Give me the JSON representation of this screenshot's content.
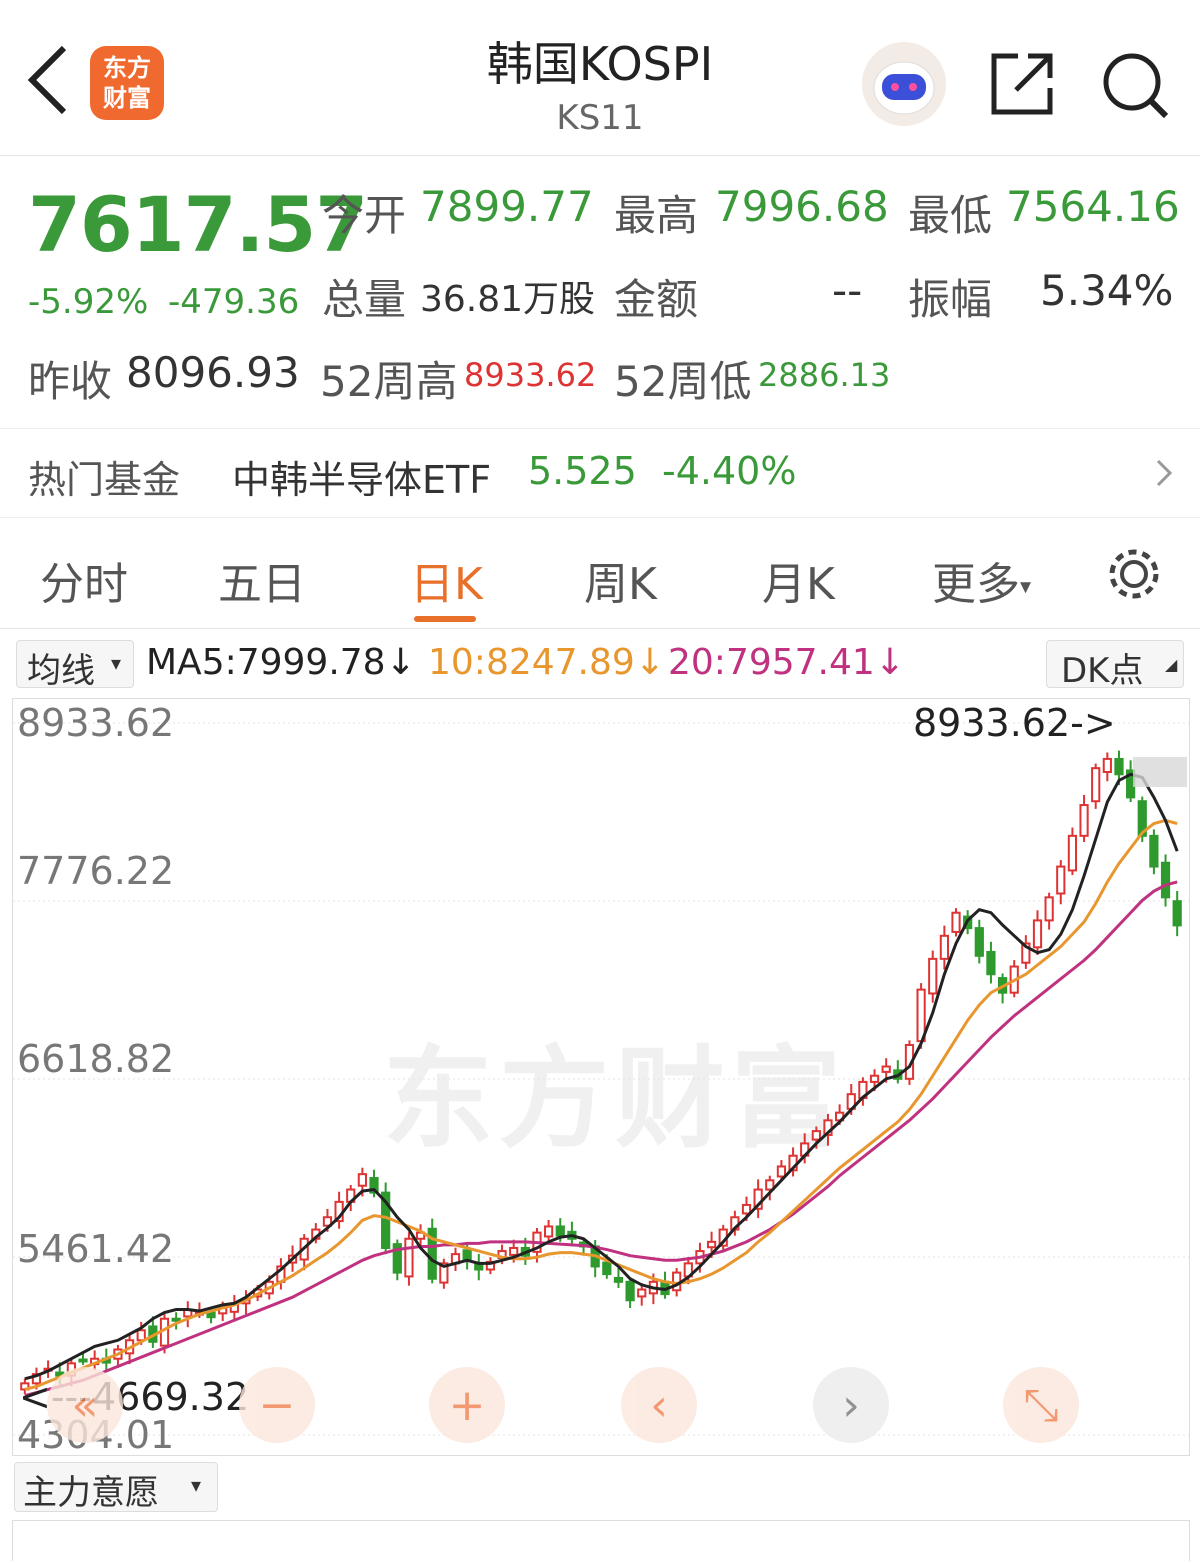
{
  "header": {
    "title": "韩国KOSPI",
    "subtitle": "KS11",
    "logo_line1": "东方",
    "logo_line2": "财富"
  },
  "quote": {
    "price": "7617.57",
    "pct_change": "-5.92%",
    "change": "-479.36",
    "open_label": "今开",
    "open": "7899.77",
    "high_label": "最高",
    "high": "7996.68",
    "low_label": "最低",
    "low": "7564.16",
    "volume_label": "总量",
    "volume": "36.81万股",
    "amount_label": "金额",
    "amount": "--",
    "amplitude_label": "振幅",
    "amplitude": "5.34%",
    "prev_close_label": "昨收",
    "prev_close": "8096.93",
    "w52_high_label": "52周高",
    "w52_high": "8933.62",
    "w52_low_label": "52周低",
    "w52_low": "2886.13"
  },
  "fund": {
    "label": "热门基金",
    "name": "中韩半导体ETF",
    "price": "5.525",
    "change": "-4.40%"
  },
  "tabs": [
    "分时",
    "五日",
    "日K",
    "周K",
    "月K",
    "更多"
  ],
  "active_tab": "日K",
  "ma": {
    "selector": "均线",
    "ma5": "MA5:7999.78",
    "ma10": "10:8247.89",
    "ma20": "20:7957.41",
    "arrow": "↓",
    "dk_button": "DK点"
  },
  "chart_data": {
    "type": "candlestick",
    "y_ticks": [
      "8933.62",
      "7776.22",
      "6618.82",
      "5461.42",
      "4304.01"
    ],
    "ylim": [
      4304.01,
      8933.62
    ],
    "max_annotation": "8933.62->",
    "min_annotation": "<---4669.32",
    "watermark": "东方财富",
    "colors": {
      "up": "#d33",
      "down": "#2e9a2e",
      "ma5": "#222222",
      "ma10": "#e8962e",
      "ma20": "#c0317f"
    },
    "closes": [
      4640,
      4700,
      4735,
      4690,
      4770,
      4790,
      4800,
      4775,
      4860,
      4920,
      4985,
      4910,
      5060,
      5050,
      5120,
      5100,
      5070,
      5130,
      5160,
      5180,
      5250,
      5300,
      5400,
      5470,
      5580,
      5640,
      5720,
      5820,
      5900,
      6000,
      5880,
      5520,
      5360,
      5580,
      5620,
      5320,
      5420,
      5480,
      5440,
      5380,
      5430,
      5500,
      5520,
      5470,
      5620,
      5660,
      5600,
      5580,
      5530,
      5400,
      5350,
      5300,
      5180,
      5250,
      5300,
      5220,
      5360,
      5420,
      5500,
      5560,
      5640,
      5720,
      5800,
      5900,
      5960,
      6050,
      6120,
      6200,
      6280,
      6350,
      6400,
      6520,
      6600,
      6640,
      6700,
      6620,
      6840,
      7200,
      7400,
      7550,
      7700,
      7600,
      7420,
      7300,
      7180,
      7350,
      7500,
      7650,
      7800,
      8000,
      8200,
      8400,
      8640,
      8700,
      8600,
      8450,
      8200,
      8000,
      7800,
      7617.57
    ],
    "ma5": [
      4669.32,
      4690,
      4720,
      4760,
      4800,
      4840,
      4880,
      4900,
      4920,
      4960,
      5000,
      5060,
      5100,
      5120,
      5120,
      5110,
      5130,
      5150,
      5160,
      5200,
      5260,
      5320,
      5380,
      5450,
      5520,
      5590,
      5650,
      5720,
      5820,
      5890,
      5900,
      5820,
      5720,
      5640,
      5520,
      5440,
      5400,
      5420,
      5440,
      5420,
      5420,
      5440,
      5460,
      5490,
      5520,
      5560,
      5590,
      5600,
      5580,
      5520,
      5460,
      5400,
      5320,
      5280,
      5260,
      5250,
      5280,
      5330,
      5400,
      5480,
      5560,
      5650,
      5720,
      5800,
      5880,
      5960,
      6040,
      6120,
      6200,
      6270,
      6340,
      6420,
      6500,
      6560,
      6620,
      6640,
      6700,
      6850,
      7050,
      7300,
      7500,
      7650,
      7720,
      7700,
      7620,
      7550,
      7480,
      7440,
      7460,
      7560,
      7720,
      7940,
      8180,
      8420,
      8560,
      8600,
      8580,
      8450,
      8300,
      8100
    ],
    "ma10": [
      4600,
      4620,
      4650,
      4680,
      4710,
      4740,
      4770,
      4800,
      4830,
      4870,
      4910,
      4950,
      4990,
      5030,
      5060,
      5090,
      5110,
      5130,
      5150,
      5180,
      5220,
      5260,
      5300,
      5340,
      5390,
      5440,
      5490,
      5550,
      5620,
      5700,
      5730,
      5720,
      5690,
      5660,
      5630,
      5580,
      5560,
      5540,
      5520,
      5500,
      5480,
      5460,
      5450,
      5450,
      5460,
      5480,
      5490,
      5490,
      5480,
      5470,
      5440,
      5410,
      5380,
      5350,
      5320,
      5300,
      5290,
      5300,
      5320,
      5350,
      5390,
      5440,
      5490,
      5560,
      5620,
      5690,
      5760,
      5830,
      5900,
      5970,
      6040,
      6100,
      6160,
      6220,
      6280,
      6340,
      6420,
      6520,
      6640,
      6760,
      6880,
      7000,
      7100,
      7180,
      7220,
      7260,
      7300,
      7360,
      7420,
      7480,
      7560,
      7640,
      7760,
      7900,
      8020,
      8120,
      8220,
      8280,
      8300,
      8280
    ],
    "ma20": [
      4560,
      4580,
      4600,
      4620,
      4640,
      4660,
      4690,
      4720,
      4750,
      4780,
      4810,
      4840,
      4870,
      4900,
      4930,
      4960,
      4990,
      5020,
      5050,
      5080,
      5110,
      5140,
      5170,
      5200,
      5240,
      5280,
      5320,
      5360,
      5400,
      5440,
      5470,
      5490,
      5510,
      5520,
      5530,
      5530,
      5540,
      5540,
      5550,
      5550,
      5560,
      5560,
      5560,
      5560,
      5555,
      5550,
      5545,
      5540,
      5535,
      5525,
      5510,
      5490,
      5470,
      5460,
      5450,
      5440,
      5440,
      5450,
      5460,
      5480,
      5500,
      5530,
      5560,
      5600,
      5640,
      5690,
      5740,
      5800,
      5860,
      5920,
      5990,
      6050,
      6110,
      6170,
      6230,
      6290,
      6350,
      6420,
      6490,
      6570,
      6650,
      6730,
      6810,
      6890,
      6960,
      7030,
      7090,
      7150,
      7210,
      7270,
      7330,
      7390,
      7460,
      7540,
      7620,
      7700,
      7780,
      7840,
      7880,
      7900
    ]
  },
  "chart_controls": [
    "«",
    "−",
    "+",
    "‹",
    "›",
    "⤡"
  ],
  "indicator_selector": "主力意愿"
}
